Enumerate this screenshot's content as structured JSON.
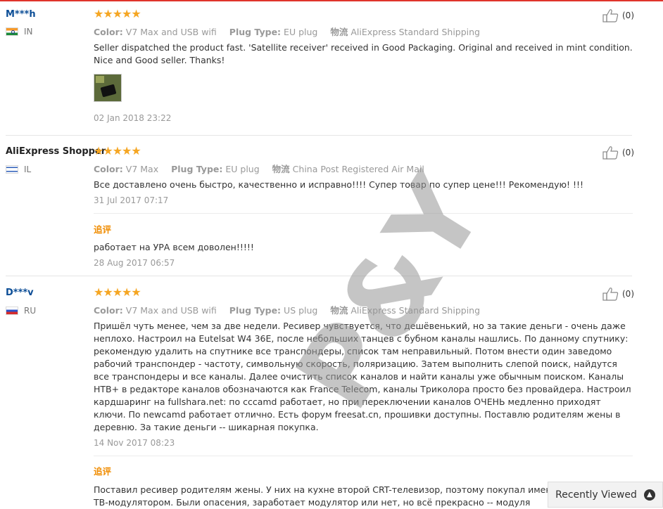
{
  "reviews": [
    {
      "user": "M***h",
      "country": "IN",
      "stars": "★★★★★",
      "color_label": "Color:",
      "color_value": "V7 Max and USB wifi",
      "plug_label": "Plug Type:",
      "plug_value": "EU plug",
      "shipping_label": "物流",
      "shipping_value": "AliExpress Standard Shipping",
      "text": "Seller dispatched the product fast. 'Satellite receiver' received in Good Packaging. Original and received in mint condition. Nice and Good seller. Thanks!",
      "date": "02 Jan 2018 23:22",
      "helpful": "(0)"
    },
    {
      "user": "AliExpress Shopper",
      "country": "IL",
      "stars": "★★★★★",
      "color_label": "Color:",
      "color_value": "V7 Max",
      "plug_label": "Plug Type:",
      "plug_value": "EU plug",
      "shipping_label": "物流",
      "shipping_value": "China Post Registered Air Mail",
      "text": "Все доставлено очень быстро, качественно и исправно!!!! Супер товар по супер цене!!! Рекомендую! !!!",
      "date": "31 Jul 2017 07:17",
      "followup_label": "追评",
      "followup_text": "работает на УРА всем доволен!!!!!",
      "followup_date": "28 Aug 2017 06:57",
      "helpful": "(0)"
    },
    {
      "user": "D***v",
      "country": "RU",
      "stars": "★★★★★",
      "color_label": "Color:",
      "color_value": "V7 Max and USB wifi",
      "plug_label": "Plug Type:",
      "plug_value": "US plug",
      "shipping_label": "物流",
      "shipping_value": "AliExpress Standard Shipping",
      "text": "Пришёл чуть менее, чем за две недели. Ресивер чувствуется, что дешёвенький, но за такие деньги - очень даже неплохо. Настроил на Eutelsat W4 36E, после небольших танцев с бубном каналы нашлись. По данному спутнику: рекомендую удалить на спутнике все транспондеры, список там неправильный. Потом внести один заведомо рабочий транспондер - частоту, символьную скорость, поляризацию. Затем выполнить слепой поиск, найдутся все транспондеры и все каналы. Далее очистить список каналов и найти каналы уже обычным поиском. Каналы НТВ+ в редакторе каналов обозначаются как France Telecom, каналы Триколора просто без провайдера. Настроил кардшаринг на fullshara.net: по cccamd работает, но при переключении каналов ОЧЕНЬ медленно приходят ключи. По newcamd работает отлично. Есть форум freesat.cn, прошивки доступны. Поставлю родителям жены в деревню. За такие деньги -- шикарная покупка.",
      "date": "14 Nov 2017 08:23",
      "followup_label": "追评",
      "followup_text": "Поставил ресивер родителям жены. У них на кухне второй CRT-телевизор, поэтому покупал именно в V7 Max, с ТВ-модулятором. Были опасения, заработает модулятор или нет, но всё прекрасно -- модуля",
      "helpful": "(0)"
    }
  ],
  "watermark": "P&Y",
  "recently_viewed": {
    "label": "Recently Viewed",
    "icon": "chevron-up-icon"
  },
  "colors": {
    "accent_red": "#e0342b",
    "star": "#f5a623",
    "user_link": "#0b4d96",
    "followup": "#f08c00"
  }
}
